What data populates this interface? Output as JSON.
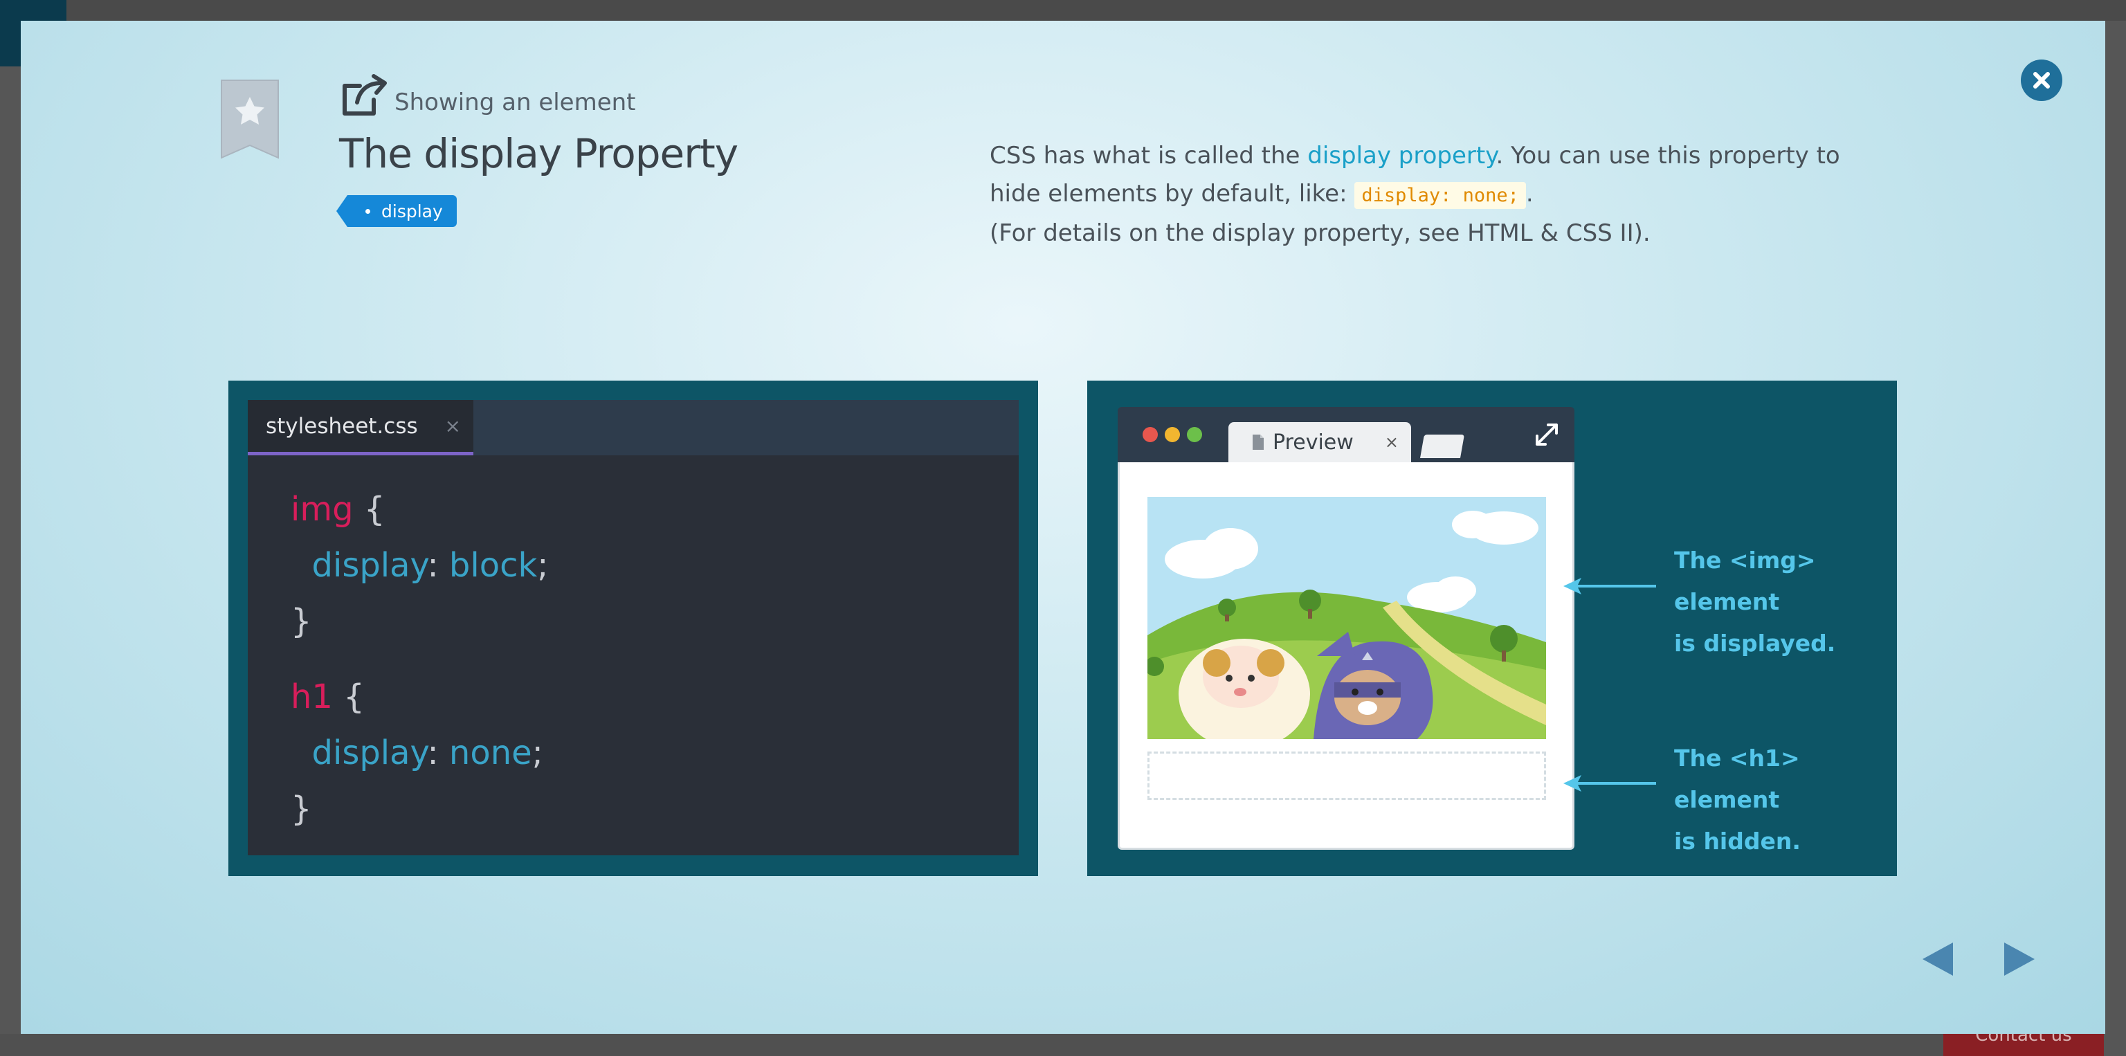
{
  "background": {
    "contact_label": "Contact us"
  },
  "lesson": {
    "subtitle": "Showing an element",
    "title": "The display Property",
    "tag": "display",
    "description": {
      "part1": "CSS has what is called the ",
      "link": "display property",
      "part2": ". You can use this property to hide elements by default, like: ",
      "code": "display: none;",
      "part3": ".",
      "part4": "(For details on the display property, see HTML & CSS II)."
    }
  },
  "editor": {
    "tab_label": "stylesheet.css",
    "tab_close": "×",
    "code": {
      "rule1": {
        "selector": "img",
        "open": " {",
        "property": "display",
        "colon": ": ",
        "value": "block",
        "semi": ";",
        "close": "}"
      },
      "rule2": {
        "selector": "h1",
        "open": " {",
        "property": "display",
        "colon": ": ",
        "value": "none",
        "semi": ";",
        "close": "}"
      }
    }
  },
  "preview": {
    "tab_label": "Preview",
    "tab_close": "×",
    "annotation_img_line1": "The <img> element",
    "annotation_img_line2": "is displayed.",
    "annotation_h1_line1": "The <h1> element",
    "annotation_h1_line2": "is hidden."
  },
  "colors": {
    "accent": "#1aa0c8",
    "tag": "#1588d8",
    "panel": "#0d5566",
    "selector": "#d81e5b",
    "property": "#3aa4c8",
    "annotation": "#55c6ea"
  },
  "icons": {
    "bookmark": "bookmark-star-icon",
    "external": "external-link-icon",
    "close": "close-icon",
    "prev": "prev-arrow-icon",
    "next": "next-arrow-icon",
    "expand": "expand-icon"
  }
}
